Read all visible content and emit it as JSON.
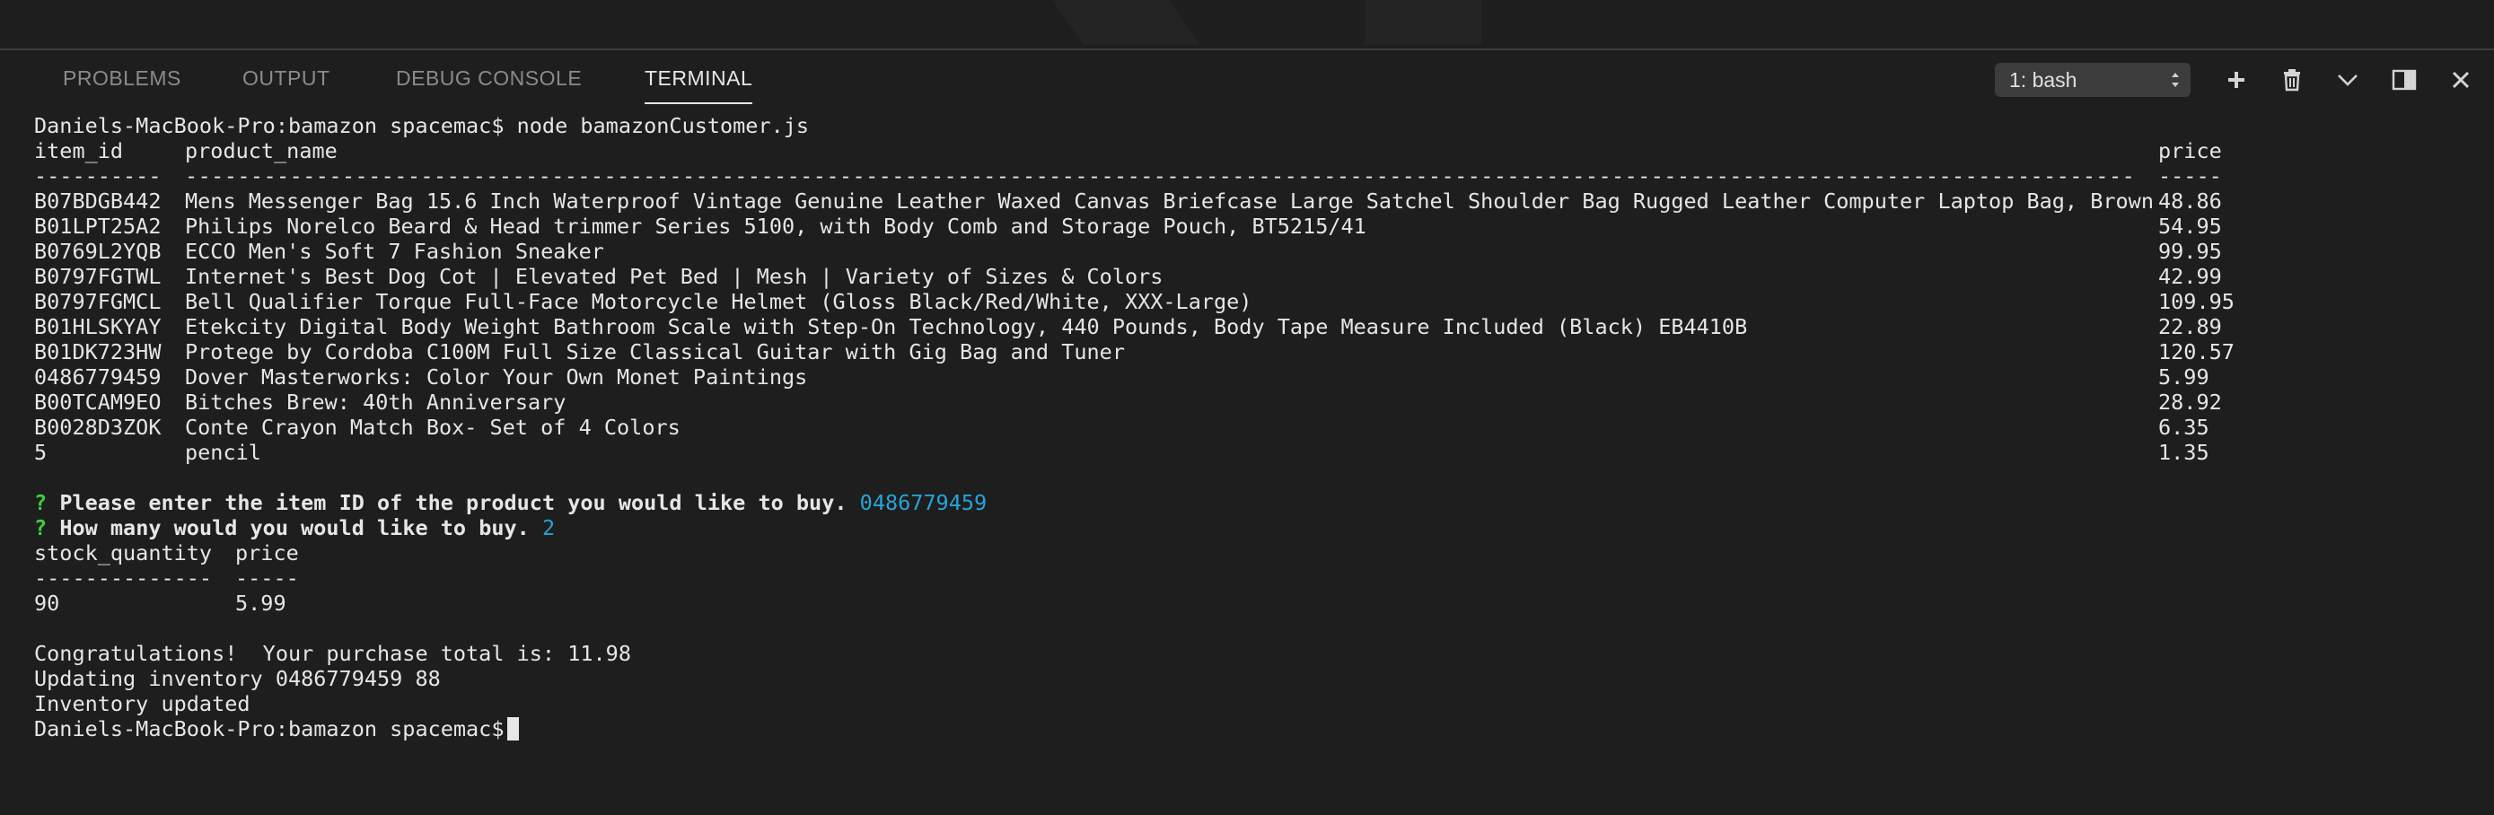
{
  "panel": {
    "tabs": [
      {
        "label": "PROBLEMS"
      },
      {
        "label": "OUTPUT"
      },
      {
        "label": "DEBUG CONSOLE"
      },
      {
        "label": "TERMINAL"
      }
    ],
    "active_tab": "TERMINAL",
    "terminal_select": {
      "value": "1: bash"
    }
  },
  "terminal": {
    "prompt": "Daniels-MacBook-Pro:bamazon spacemac$",
    "command": "node bamazonCustomer.js",
    "product_table": {
      "headers": {
        "item_id": "item_id",
        "product_name": "product_name",
        "price": "price"
      },
      "rules": {
        "item_id": "----------",
        "product_name": "-----------------------------------------------------------------------------------------------------------------------------------------------------",
        "price": "-----"
      },
      "rows": [
        {
          "item_id": "B07BDGB442",
          "product_name": "Mens Messenger Bag 15.6 Inch Waterproof Vintage Genuine Leather Waxed Canvas Briefcase Large Satchel Shoulder Bag Rugged Leather Computer Laptop Bag, Brown",
          "price": "48.86"
        },
        {
          "item_id": "B01LPT25A2",
          "product_name": "Philips Norelco Beard & Head trimmer Series 5100, with Body Comb and Storage Pouch, BT5215/41",
          "price": "54.95"
        },
        {
          "item_id": "B0769L2YQB",
          "product_name": "ECCO Men's Soft 7 Fashion Sneaker",
          "price": "99.95"
        },
        {
          "item_id": "B0797FGTWL",
          "product_name": "Internet's Best Dog Cot | Elevated Pet Bed | Mesh | Variety of Sizes & Colors",
          "price": "42.99"
        },
        {
          "item_id": "B0797FGMCL",
          "product_name": "Bell Qualifier Torque Full-Face Motorcycle Helmet (Gloss Black/Red/White, XXX-Large)",
          "price": "109.95"
        },
        {
          "item_id": "B01HLSKYAY",
          "product_name": "Etekcity Digital Body Weight Bathroom Scale with Step-On Technology, 440 Pounds, Body Tape Measure Included (Black) EB4410B",
          "price": "22.89"
        },
        {
          "item_id": "B01DK723HW",
          "product_name": "Protege by Cordoba C100M Full Size Classical Guitar with Gig Bag and Tuner",
          "price": "120.57"
        },
        {
          "item_id": "0486779459",
          "product_name": "Dover Masterworks: Color Your Own Monet Paintings",
          "price": "5.99"
        },
        {
          "item_id": "B00TCAM9EO",
          "product_name": "Bitches Brew: 40th Anniversary",
          "price": "28.92"
        },
        {
          "item_id": "B0028D3ZOK",
          "product_name": "Conte Crayon Match Box- Set of 4 Colors",
          "price": "6.35"
        },
        {
          "item_id": "5",
          "product_name": "pencil",
          "price": "1.35"
        }
      ]
    },
    "question1": {
      "mark": "?",
      "text": "Please enter the item ID of the product you would like to buy.",
      "answer": "0486779459"
    },
    "question2": {
      "mark": "?",
      "text": "How many would you would like to buy.",
      "answer": "2"
    },
    "stock_table": {
      "headers": {
        "stock_quantity": "stock_quantity",
        "price": "price"
      },
      "rules": {
        "stock_quantity": "--------------",
        "price": "-----"
      },
      "row": {
        "stock_quantity": "90",
        "price": "5.99"
      }
    },
    "messages": [
      "Congratulations!  Your purchase total is: 11.98",
      "Updating inventory 0486779459 88",
      "Inventory updated"
    ],
    "final_prompt": "Daniels-MacBook-Pro:bamazon spacemac$"
  },
  "icons": {
    "new_terminal": "plus-icon",
    "kill_terminal": "trash-icon",
    "collapse_panel": "chevron-down-icon",
    "toggle_layout": "split-layout-icon",
    "close_panel": "close-icon"
  }
}
